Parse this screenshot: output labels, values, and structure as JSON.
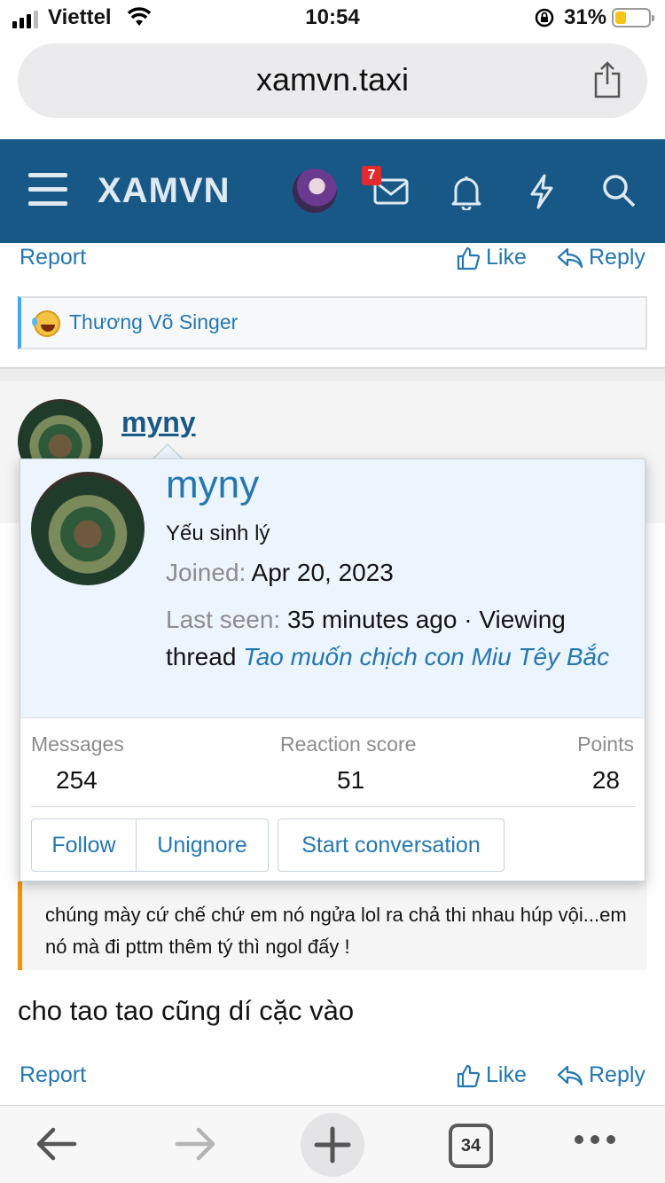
{
  "status": {
    "carrier": "Viettel",
    "time": "10:54",
    "battery": "31%"
  },
  "browser": {
    "url": "xamvn.taxi",
    "tab_count": "34"
  },
  "site": {
    "logo": "XAMVN",
    "inbox_badge": "7"
  },
  "post_actions": {
    "report": "Report",
    "like": "Like",
    "reply": "Reply"
  },
  "reactions": {
    "user": "Thương Võ Singer"
  },
  "post": {
    "username": "myny",
    "quote": "chúng mày cứ chế chứ em nó ngửa lol ra chả thi nhau húp vội...em nó mà đi pttm thêm tý thì ngol đấy !",
    "body": "cho tao tao cũng dí cặc vào"
  },
  "member_card": {
    "name": "myny",
    "user_title": "Yếu sinh lý",
    "joined_label": "Joined:",
    "joined_value": "Apr 20, 2023",
    "last_seen_label": "Last seen:",
    "last_seen_value": "35 minutes ago · Viewing thread",
    "thread_title": "Tao muốn chịch con Miu Têy Bắc",
    "stats": [
      {
        "label": "Messages",
        "value": "254"
      },
      {
        "label": "Reaction score",
        "value": "51"
      },
      {
        "label": "Points",
        "value": "28"
      }
    ],
    "buttons": {
      "follow": "Follow",
      "unignore": "Unignore",
      "conversation": "Start conversation"
    }
  }
}
